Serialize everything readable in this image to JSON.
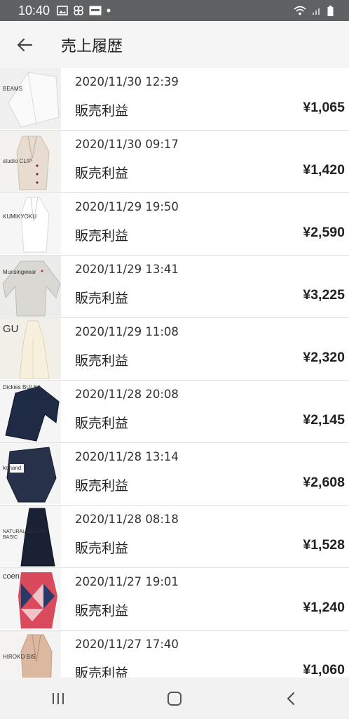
{
  "status": {
    "time": "10:40"
  },
  "header": {
    "title": "売上履歴"
  },
  "items": [
    {
      "brand": "BEAMS",
      "date": "2020/11/30 12:39",
      "label": "販売利益",
      "price": "¥1,065"
    },
    {
      "brand": "studio CLIP",
      "date": "2020/11/30 09:17",
      "label": "販売利益",
      "price": "¥1,420"
    },
    {
      "brand": "KUMIKYOKU",
      "date": "2020/11/29 19:50",
      "label": "販売利益",
      "price": "¥2,590"
    },
    {
      "brand": "Munsingwear",
      "date": "2020/11/29 13:41",
      "label": "販売利益",
      "price": "¥3,225"
    },
    {
      "brand": "GU",
      "date": "2020/11/29 11:08",
      "label": "販売利益",
      "price": "¥2,320"
    },
    {
      "brand": "Dickies BULSA",
      "date": "2020/11/28 20:08",
      "label": "販売利益",
      "price": "¥2,145"
    },
    {
      "brand": "kehand",
      "date": "2020/11/28 13:14",
      "label": "販売利益",
      "price": "¥2,608"
    },
    {
      "brand": "NATURAL BEAUTY BASIC",
      "date": "2020/11/28 08:18",
      "label": "販売利益",
      "price": "¥1,528"
    },
    {
      "brand": "coen",
      "date": "2020/11/27 19:01",
      "label": "販売利益",
      "price": "¥1,240"
    },
    {
      "brand": "HIROKO BIS",
      "date": "2020/11/27 17:40",
      "label": "販売利益",
      "price": "¥1,060"
    }
  ],
  "icons": {
    "back": "arrow-left-icon",
    "nav_recents": "recents-icon",
    "nav_home": "home-icon",
    "nav_back": "back-icon"
  },
  "colors": {
    "statusbar": "#5f6163",
    "appbar": "#f5f5f5",
    "navbar": "#f2f2f2"
  }
}
